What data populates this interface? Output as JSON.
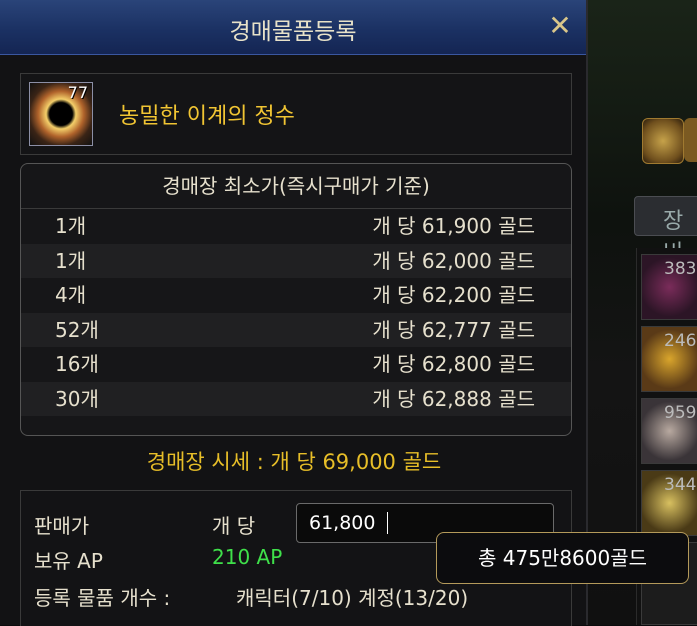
{
  "window": {
    "title": "경매물품등록",
    "close_symbol": "✕"
  },
  "item": {
    "name": "농밀한 이계의 정수",
    "count": "77",
    "icon": "dark-essence-icon"
  },
  "price_table": {
    "header": "경매장 최소가(즉시구매가 기준)",
    "rows": [
      {
        "qty": "1개",
        "per": "개 당 61,900 골드"
      },
      {
        "qty": "1개",
        "per": "개 당 62,000 골드"
      },
      {
        "qty": "4개",
        "per": "개 당 62,200 골드"
      },
      {
        "qty": "52개",
        "per": "개 당 62,777 골드"
      },
      {
        "qty": "16개",
        "per": "개 당 62,800 골드"
      },
      {
        "qty": "30개",
        "per": "개 당 62,888 골드"
      }
    ]
  },
  "market_price": "경매장 시세 : 개 당 69,000 골드",
  "sell": {
    "price_label": "판매가",
    "per_label": "개 당",
    "price_value": "61,800",
    "ap_label": "보유 AP",
    "ap_value": "210 AP",
    "count_label": "등록 물품 개수 :",
    "count_value": "캐릭터(7/10) 계정(13/20)"
  },
  "tooltip": {
    "total": "총 475만8600골드"
  },
  "background": {
    "tab_label": "장비",
    "side_counts": [
      "383",
      "246",
      "959",
      "344"
    ]
  },
  "colors": {
    "accent_gold": "#f1c533",
    "ap_green": "#3fe04a",
    "titlebar_blue": "#1b3163"
  }
}
